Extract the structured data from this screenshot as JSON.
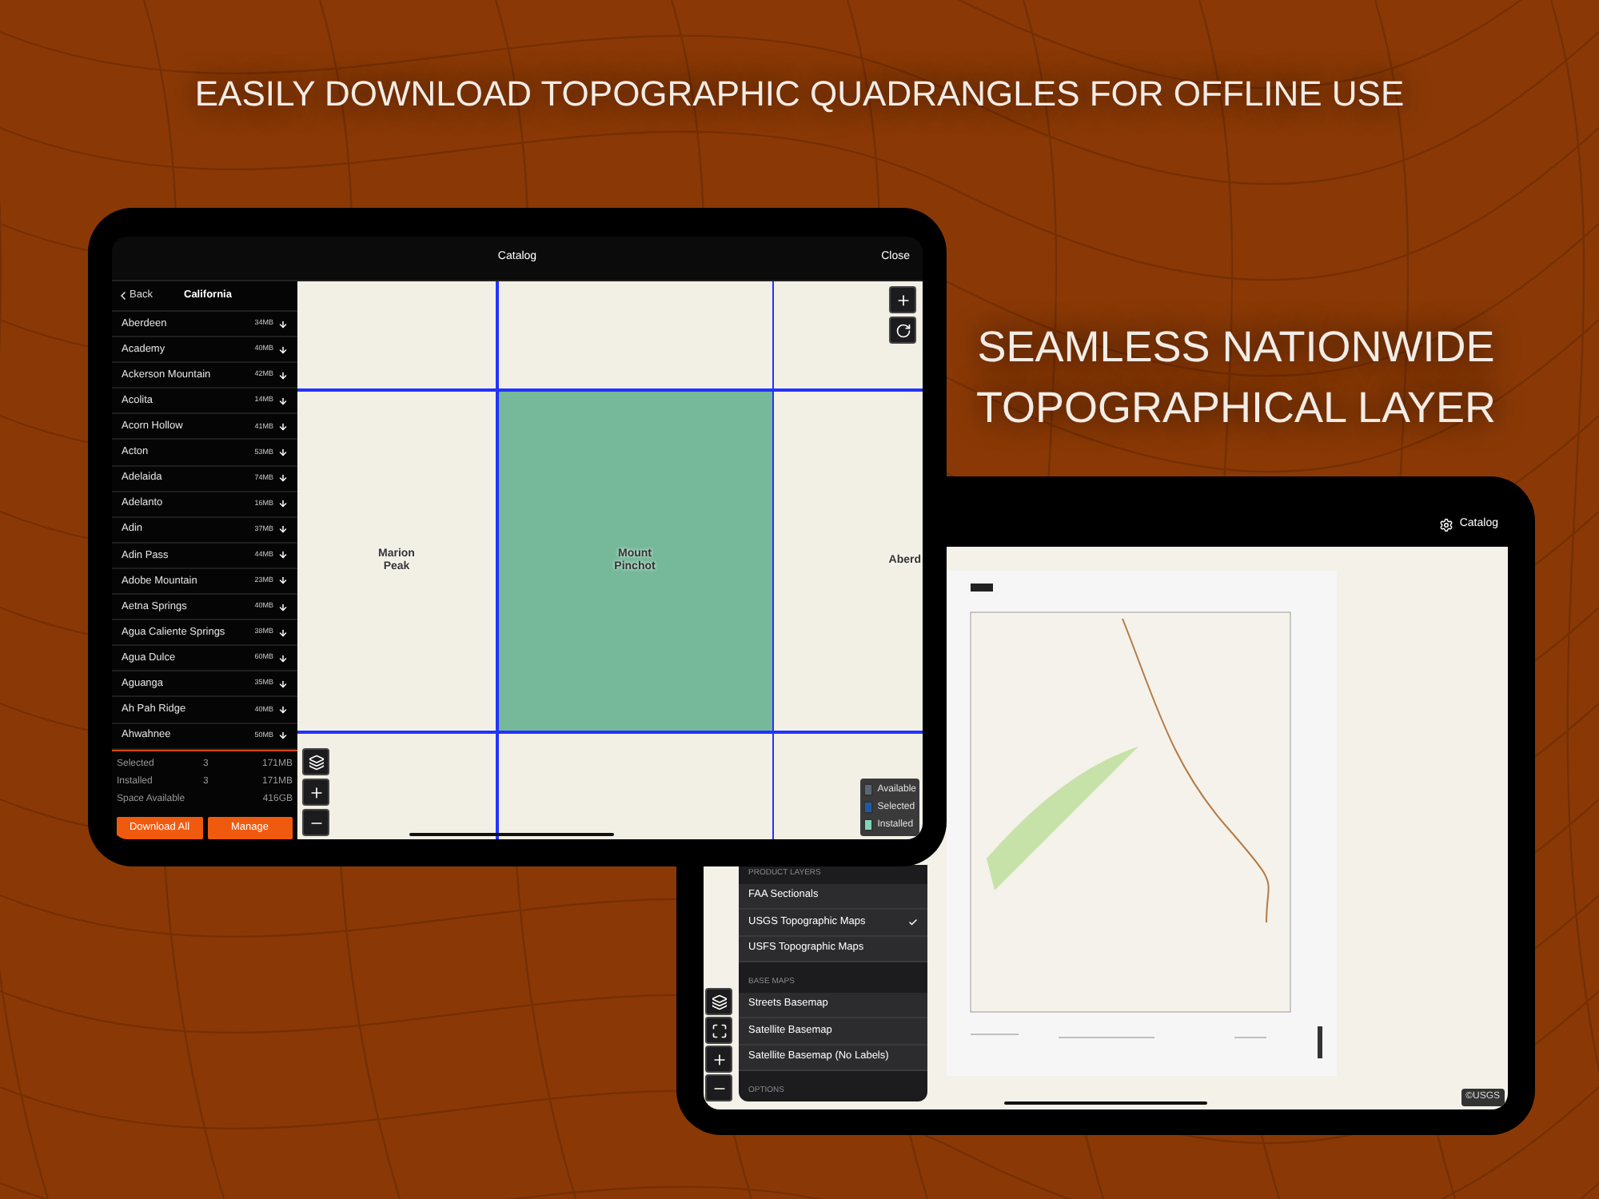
{
  "headline": "EASILY DOWNLOAD TOPOGRAPHIC QUADRANGLES FOR OFFLINE USE",
  "subheadline": "SEAMLESS NATIONWIDE TOPOGRAPHICAL LAYER",
  "catalog_screen": {
    "title": "Catalog",
    "close": "Close",
    "back": "Back",
    "region": "California",
    "quads": [
      {
        "name": "Aberdeen",
        "size": "34MB"
      },
      {
        "name": "Academy",
        "size": "40MB"
      },
      {
        "name": "Ackerson Mountain",
        "size": "42MB"
      },
      {
        "name": "Acolita",
        "size": "14MB"
      },
      {
        "name": "Acorn Hollow",
        "size": "41MB"
      },
      {
        "name": "Acton",
        "size": "53MB"
      },
      {
        "name": "Adelaida",
        "size": "74MB"
      },
      {
        "name": "Adelanto",
        "size": "16MB"
      },
      {
        "name": "Adin",
        "size": "37MB"
      },
      {
        "name": "Adin Pass",
        "size": "44MB"
      },
      {
        "name": "Adobe Mountain",
        "size": "23MB"
      },
      {
        "name": "Aetna Springs",
        "size": "40MB"
      },
      {
        "name": "Agua Caliente Springs",
        "size": "38MB"
      },
      {
        "name": "Agua Dulce",
        "size": "60MB"
      },
      {
        "name": "Aguanga",
        "size": "35MB"
      },
      {
        "name": "Ah Pah Ridge",
        "size": "40MB"
      },
      {
        "name": "Ahwahnee",
        "size": "50MB"
      }
    ],
    "summary": [
      {
        "label": "Selected",
        "count": "3",
        "size": "171MB"
      },
      {
        "label": "Installed",
        "count": "3",
        "size": "171MB"
      },
      {
        "label": "Space Available",
        "size": "416GB"
      }
    ],
    "buttons": [
      "Download All",
      "Manage"
    ],
    "map": {
      "tiles": [
        {
          "selected": false
        },
        {
          "selected": false
        },
        {
          "selected": false
        },
        {
          "label": "Marion Peak",
          "selected": false
        },
        {
          "label": "Mount Pinchot",
          "selected": true
        },
        {
          "label": "Aberd",
          "selected": false
        },
        {
          "selected": false
        },
        {
          "selected": false
        },
        {
          "selected": false
        }
      ],
      "legend": [
        {
          "label": "Available",
          "color": "#5b6673"
        },
        {
          "label": "Selected",
          "color": "#1f5aa6"
        },
        {
          "label": "Installed",
          "color": "#7fd6b6"
        }
      ]
    }
  },
  "layers_screen": {
    "title": "Catalog",
    "attribution": "©USGS",
    "menu": [
      {
        "heading": "PRODUCT LAYERS",
        "items": [
          {
            "label": "FAA Sectionals",
            "checked": false
          },
          {
            "label": "USGS Topographic Maps",
            "checked": true
          },
          {
            "label": "USFS Topographic Maps",
            "checked": false
          }
        ]
      },
      {
        "heading": "BASE MAPS",
        "items": [
          {
            "label": "Streets Basemap",
            "checked": false
          },
          {
            "label": "Satellite Basemap",
            "checked": false
          },
          {
            "label": "Satellite Basemap (No Labels)",
            "checked": false
          }
        ]
      },
      {
        "heading": "OPTIONS"
      }
    ]
  }
}
